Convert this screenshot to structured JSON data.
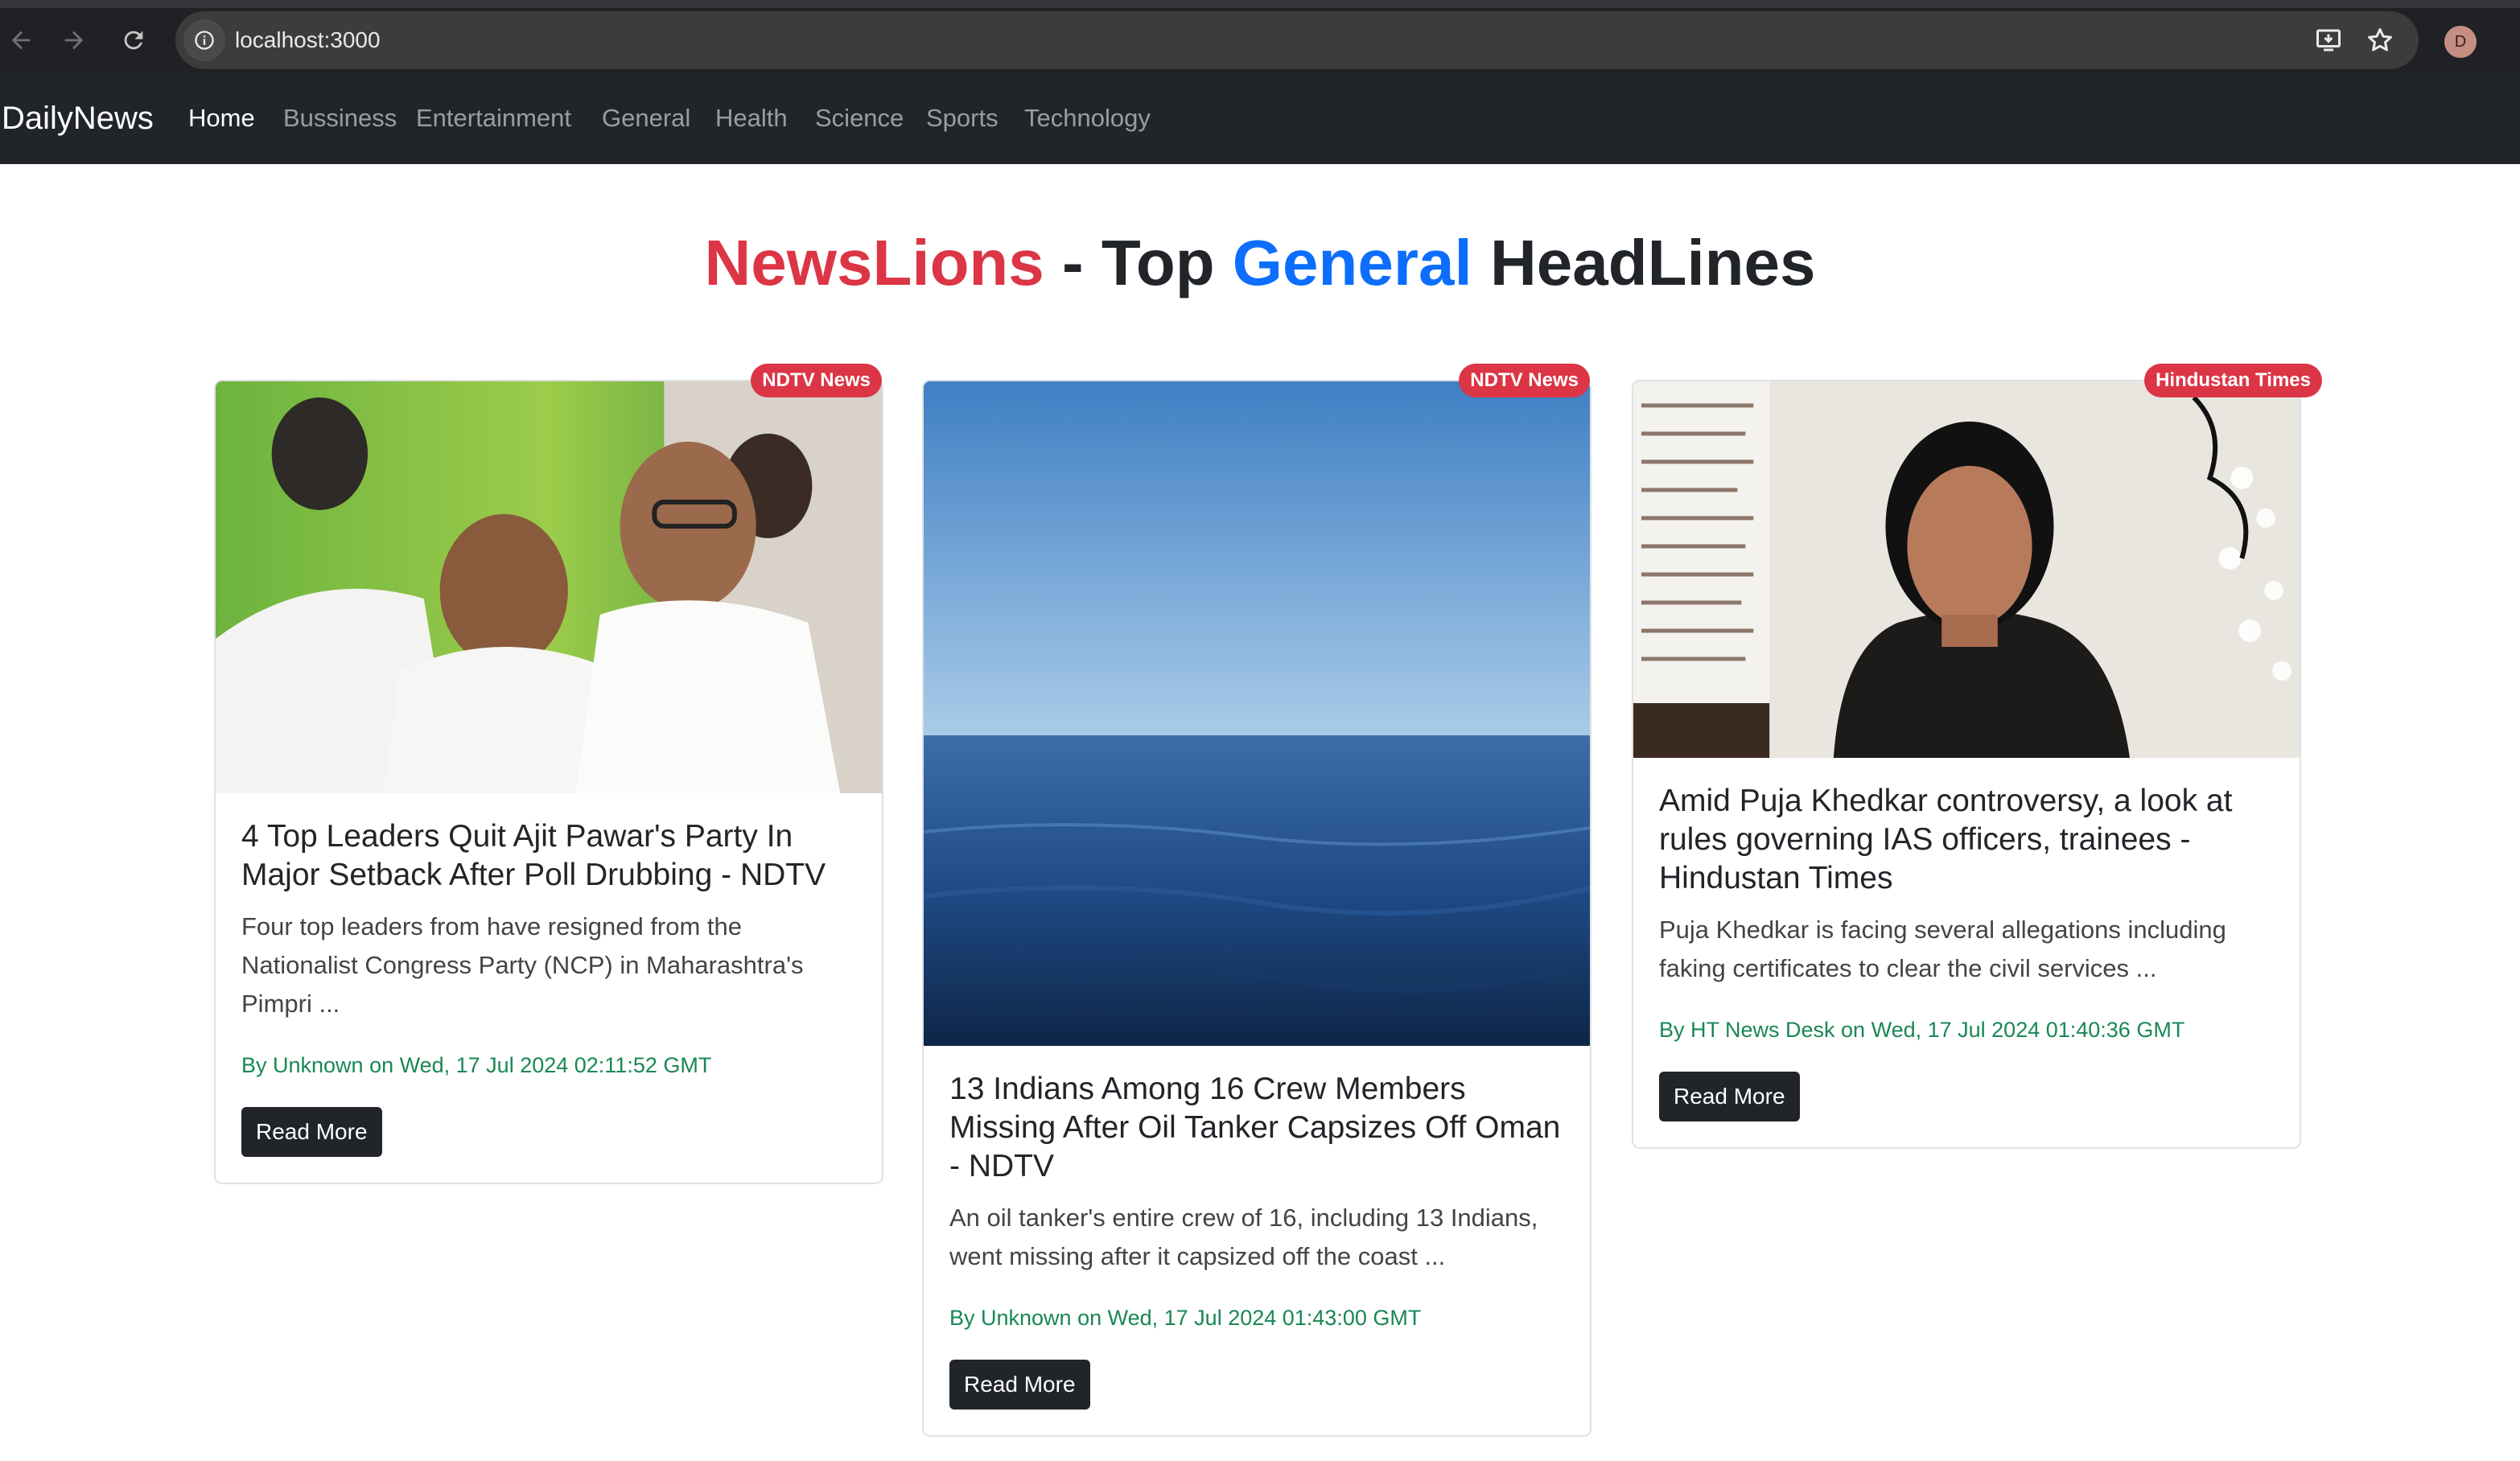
{
  "browser": {
    "url": "localhost:3000",
    "profile_initial": "D"
  },
  "navbar": {
    "brand": "DailyNews",
    "links": [
      "Home",
      "Bussiness",
      "Entertainment",
      "General",
      "Health",
      "Science",
      "Sports",
      "Technology"
    ],
    "active": "Home"
  },
  "heading": {
    "part1": "NewsLions",
    "part2": " - Top ",
    "part3": "General",
    "part4": " HeadLines"
  },
  "articles": [
    {
      "source": "NDTV News",
      "title": "4 Top Leaders Quit Ajit Pawar's Party In Major Setback After Poll Drubbing - NDTV",
      "description": "Four top leaders from have resigned from the Nationalist Congress Party (NCP) in Maharashtra's Pimpri ...",
      "meta": "By Unknown on Wed, 17 Jul 2024 02:11:52 GMT",
      "button": "Read More"
    },
    {
      "source": "NDTV News",
      "title": "13 Indians Among 16 Crew Members Missing After Oil Tanker Capsizes Off Oman - NDTV",
      "description": "An oil tanker's entire crew of 16, including 13 Indians, went missing after it capsized off the coast ...",
      "meta": "By Unknown on Wed, 17 Jul 2024 01:43:00 GMT",
      "button": "Read More"
    },
    {
      "source": "Hindustan Times",
      "title": "Amid Puja Khedkar controversy, a look at rules governing IAS officers, trainees - Hindustan Times",
      "description": "Puja Khedkar is facing several allegations including faking certificates to clear the civil services ...",
      "meta": "By HT News Desk on Wed, 17 Jul 2024 01:40:36 GMT",
      "button": "Read More"
    }
  ]
}
